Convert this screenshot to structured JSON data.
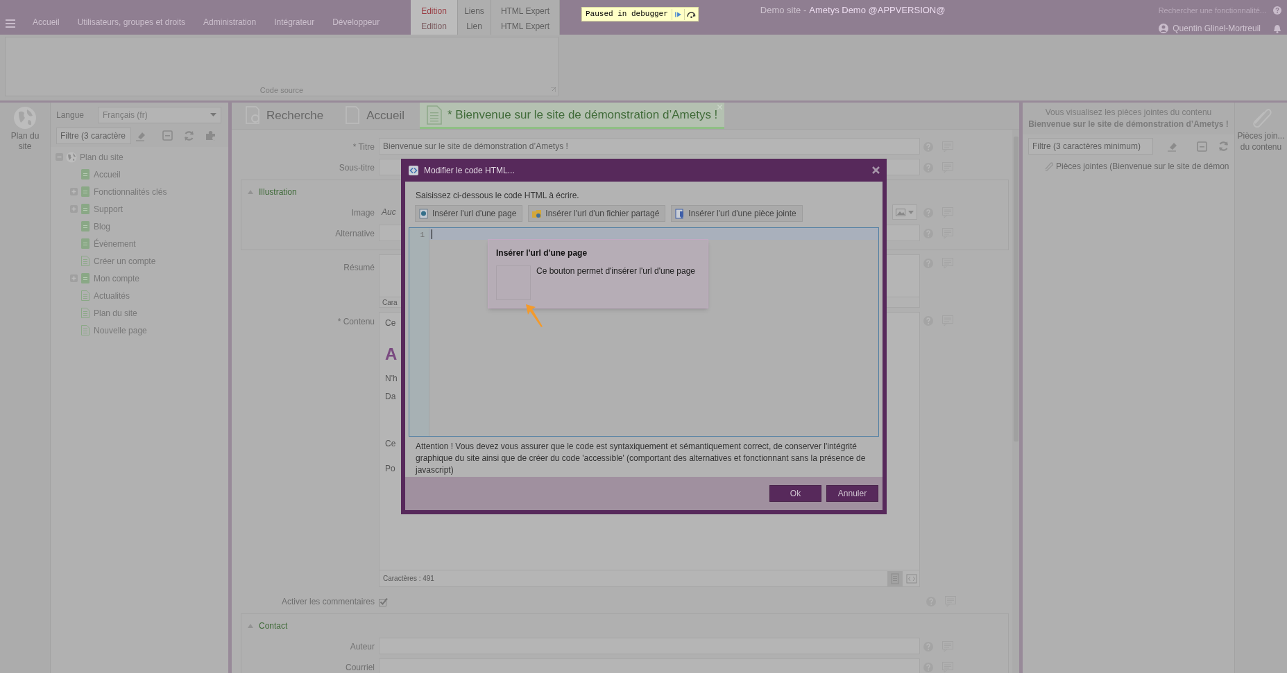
{
  "app_bar": {
    "tabs": [
      "Accueil",
      "Utilisateurs, groupes et droits",
      "Administration",
      "Intégrateur",
      "Développeur"
    ],
    "contextual_tabs": [
      {
        "group": "Edition",
        "label": "Edition",
        "selected": true
      },
      {
        "group": "Liens",
        "label": "Lien",
        "selected": false
      },
      {
        "group": "HTML Expert",
        "label": "HTML Expert",
        "selected": false
      }
    ],
    "debugger_badge": "Paused in debugger",
    "site_name": "Demo site -",
    "app_version": "Ametys Demo @APPVERSION@",
    "search_placeholder": "Rechercher une fonctionnalité...",
    "user": "Quentin Glinel-Mortreuil"
  },
  "ribbon": {
    "panel_label": "Code source"
  },
  "site_map_tool": {
    "label": "Plan du site"
  },
  "site_tree": {
    "language_label": "Langue",
    "language": "Français (fr)",
    "filter_placeholder": "Filtre (3 caractère",
    "root": {
      "label": "Plan du site",
      "expanded": true,
      "children": [
        {
          "label": "Accueil",
          "has_children": false,
          "has_content": true
        },
        {
          "label": "Fonctionnalités clés",
          "has_children": true,
          "has_content": true
        },
        {
          "label": "Support",
          "has_children": true,
          "has_content": true
        },
        {
          "label": "Blog",
          "has_children": false,
          "has_content": true
        },
        {
          "label": "Évènement",
          "has_children": false,
          "has_content": true
        },
        {
          "label": "Créer un compte",
          "has_children": false,
          "has_content": false
        },
        {
          "label": "Mon compte",
          "has_children": true,
          "has_content": true
        },
        {
          "label": "Actualités",
          "has_children": false,
          "has_content": false
        },
        {
          "label": "Plan du site",
          "has_children": false,
          "has_content": false
        },
        {
          "label": "Nouvelle page",
          "has_children": false,
          "has_content": false
        }
      ]
    }
  },
  "editor_tabs": [
    {
      "label": "Recherche",
      "selected": false,
      "kind": "search"
    },
    {
      "label": "Accueil",
      "selected": false,
      "kind": "page"
    },
    {
      "label": "* Bienvenue sur le site de démonstration d’Ametys !",
      "selected": true,
      "kind": "content"
    }
  ],
  "form": [
    {
      "kind": "text",
      "label": "* Titre",
      "value": "Bienvenue sur le site de démonstration d’Ametys !"
    },
    {
      "kind": "text",
      "label": "Sous-titre"
    },
    {
      "kind": "section",
      "label": "Illustration",
      "expanded": true,
      "rows": [
        {
          "kind": "image",
          "label": "Image",
          "value": "Auc"
        },
        {
          "kind": "text",
          "label": "Alternative"
        }
      ]
    },
    {
      "kind": "textarea",
      "label": "Résumé",
      "footer": "Cara"
    },
    {
      "kind": "richtext",
      "label": "* Contenu",
      "footer": "Caractères : 491",
      "fragments": [
        {
          "kind": "p",
          "text": "Ce"
        },
        {
          "kind": "heading",
          "text": "A"
        },
        {
          "kind": "p",
          "text": "N'h"
        },
        {
          "kind": "p",
          "text": "Da"
        },
        {
          "kind": "p",
          "text": "Ce"
        },
        {
          "kind": "p",
          "text": "Po"
        }
      ]
    },
    {
      "kind": "checkbox",
      "label": "Activer les commentaires",
      "checked": true
    },
    {
      "kind": "section",
      "label": "Contact",
      "expanded": true,
      "rows": [
        {
          "kind": "text",
          "label": "Auteur"
        },
        {
          "kind": "text",
          "label": "Courriel"
        }
      ]
    }
  ],
  "attachments_panel": {
    "intro": "Vous visualisez les pièces jointes du contenu **Bienvenue sur le site de démonstration d’Ametys !**",
    "filter_placeholder": "Filtre (3 caractères minimum)",
    "tree_item": "Pièces jointes (Bienvenue sur le site de démon"
  },
  "attachments_tool": {
    "label": "Pièces join...",
    "label_line2": "du contenu"
  },
  "dialog": {
    "title": "Modifier le code HTML...",
    "instructions": "Saisissez ci-dessous le code HTML à écrire.",
    "insert_buttons": [
      {
        "kind": "page",
        "label": "Insérer l'url d'une page"
      },
      {
        "kind": "folder",
        "label": "Insérer l'url d'un fichier partagé"
      },
      {
        "kind": "attachment",
        "label": "Insérer l'url d'une pièce jointe"
      }
    ],
    "line_numbers": [
      "1"
    ],
    "warning": "Attention ! Vous devez vous assurer que le code est syntaxiquement et sémantiquement correct, de conserver l'intégrité graphique du site ainsi que de créer du code 'accessible' (comportant des alternatives et fonctionnant sans la présence de javascript)",
    "buttons": [
      "Ok",
      "Annuler"
    ]
  },
  "tooltip": {
    "title": "Insérer l'url d'une page",
    "text": "Ce bouton permet d'insérer l'url d'une page"
  }
}
